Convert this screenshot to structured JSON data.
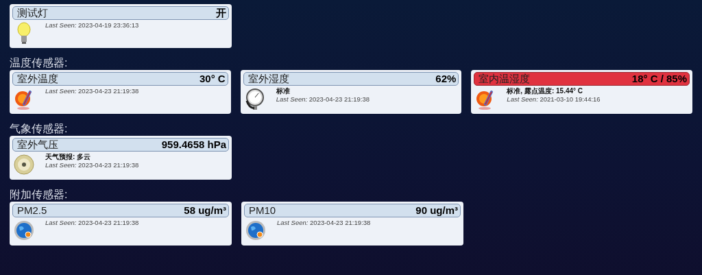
{
  "sections": [
    {
      "cards": [
        {
          "name": "测试灯",
          "value": "开",
          "alert": false,
          "kind": "bulb",
          "last_seen": "*Last Seen:* 2023-04-19 23:36:13"
        }
      ]
    },
    {
      "heading": "温度传感器:",
      "cards": [
        {
          "name": "室外温度",
          "value": "30° C",
          "alert": false,
          "kind": "thermo",
          "last_seen": "*Last Seen:* 2023-04-23 21:19:38"
        },
        {
          "name": "室外湿度",
          "value": "62%",
          "alert": false,
          "kind": "gauge",
          "status": "标准",
          "last_seen": "*Last Seen:* 2023-04-23 21:19:38"
        },
        {
          "name": "室内温湿度",
          "value": "18° C / 85%",
          "alert": true,
          "kind": "thermo",
          "status": "标准, 露点温度: 15.44° C",
          "last_seen": "*Last Seen:* 2021-03-10 19:44:16"
        }
      ]
    },
    {
      "heading": "气象传感器:",
      "cards": [
        {
          "name": "室外气压",
          "value": "959.4658 hPa",
          "alert": false,
          "kind": "barometer",
          "status": "天气预报: 多云",
          "last_seen": "*Last Seen:* 2023-04-23 21:19:38"
        }
      ]
    },
    {
      "heading": "附加传感器:",
      "cards": [
        {
          "name": "PM2.5",
          "value": "58 ug/m³",
          "alert": false,
          "kind": "globe",
          "last_seen": "*Last Seen:* 2023-04-23 21:19:38"
        },
        {
          "name": "PM10",
          "value": "90 ug/m³",
          "alert": false,
          "kind": "globe",
          "last_seen": "*Last Seen:* 2023-04-23 21:19:38"
        }
      ]
    }
  ]
}
